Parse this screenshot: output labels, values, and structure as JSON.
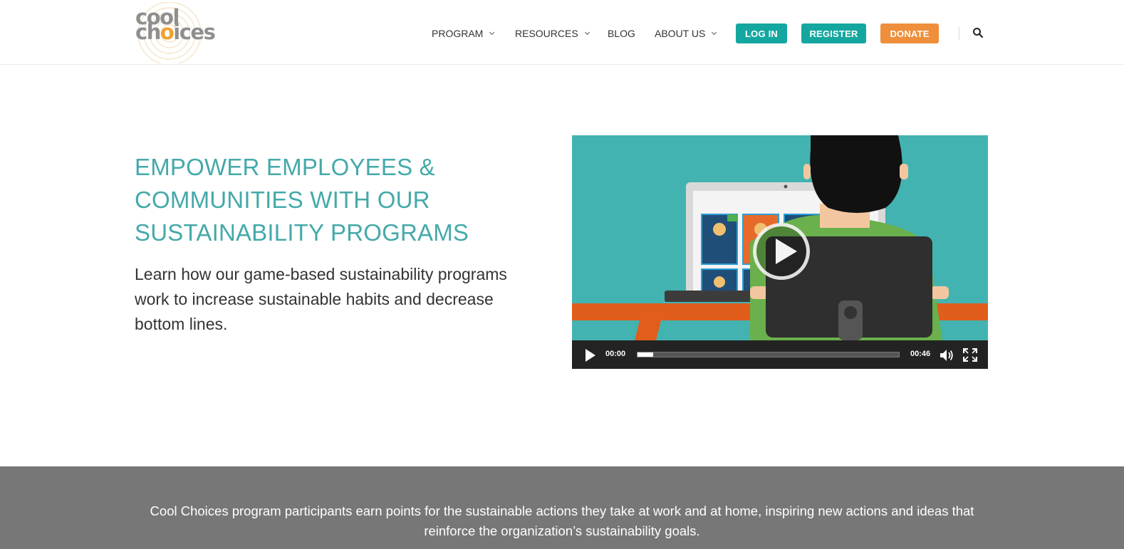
{
  "header": {
    "logo_line1": "cool",
    "logo_line2_prefix": "ch",
    "logo_line2_accent": "o",
    "logo_line2_suffix": "ices",
    "nav": [
      {
        "label": "PROGRAM",
        "has_dropdown": true
      },
      {
        "label": "RESOURCES",
        "has_dropdown": true
      },
      {
        "label": "BLOG",
        "has_dropdown": false
      },
      {
        "label": "ABOUT US",
        "has_dropdown": true
      }
    ],
    "login_label": "LOG IN",
    "register_label": "REGISTER",
    "donate_label": "DONATE",
    "search_icon": "search-icon"
  },
  "hero": {
    "title_lines": [
      "EMPOWER EMPLOYEES &",
      "COMMUNITIES WITH OUR",
      "SUSTAINABILITY PROGRAMS"
    ],
    "subtitle_lines": [
      "Learn how our game-based sustainability programs",
      "work to increase sustainable habits and decrease",
      "bottom lines."
    ]
  },
  "video": {
    "current_time": "00:00",
    "duration": "00:46",
    "progress_fraction": 0.06,
    "play_icon": "play-icon",
    "volume_icon": "volume-icon",
    "fullscreen_icon": "fullscreen-icon"
  },
  "band": {
    "text_lines": [
      "Cool Choices program participants earn points for the sustainable actions they take at work and at home, inspiring new actions and ideas that",
      "reinforce the organization’s sustainability goals."
    ]
  },
  "colors": {
    "teal_heading": "#45a9aa",
    "teal_button": "#14a7a0",
    "orange_button": "#ef8e3b",
    "band_gray": "#777777"
  }
}
